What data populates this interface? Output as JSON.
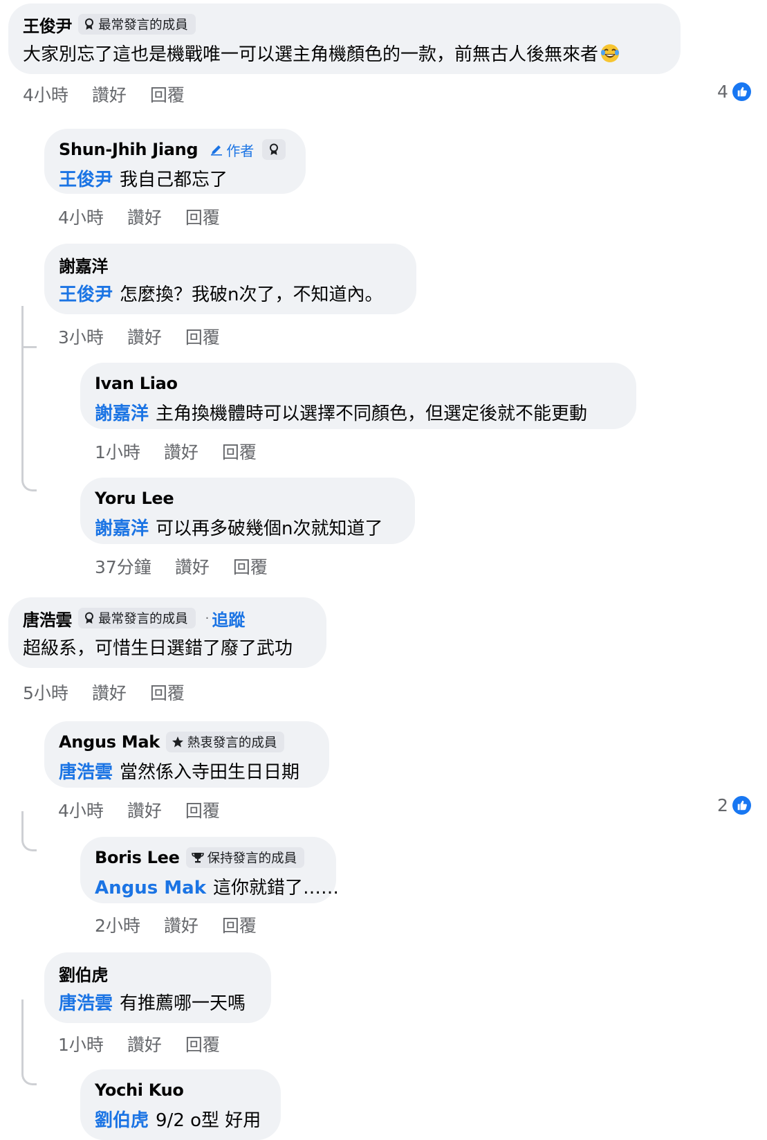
{
  "comments": [
    {
      "name": "王俊尹",
      "badge": "最常發言的成員",
      "text": "大家別忘了這也是機戰唯一可以選主角機顏色的一款，前無古人後無來者",
      "emoji_icon": "laughing-tears-emoji",
      "time": "4小時",
      "like": "讚好",
      "reply": "回覆",
      "reactions": "4"
    },
    {
      "name": "Shun-Jhih Jiang",
      "author_label": "作者",
      "mention": "王俊尹",
      "text": "我自己都忘了",
      "time": "4小時",
      "like": "讚好",
      "reply": "回覆"
    },
    {
      "name": "謝嘉洋",
      "mention": "王俊尹",
      "text": "怎麼換？我破n次了，不知道內。",
      "time": "3小時",
      "like": "讚好",
      "reply": "回覆"
    },
    {
      "name": "Ivan Liao",
      "mention": "謝嘉洋",
      "text": "主角換機體時可以選擇不同顏色，但選定後就不能更動",
      "time": "1小時",
      "like": "讚好",
      "reply": "回覆"
    },
    {
      "name": "Yoru Lee",
      "mention": "謝嘉洋",
      "text": "可以再多破幾個n次就知道了",
      "time": "37分鐘",
      "like": "讚好",
      "reply": "回覆"
    },
    {
      "name": "唐浩雲",
      "badge": "最常發言的成員",
      "follow": "追蹤",
      "text": "超級系，可惜生日選錯了廢了武功",
      "time": "5小時",
      "like": "讚好",
      "reply": "回覆"
    },
    {
      "name": "Angus Mak",
      "badge": "熱衷發言的成員",
      "mention": "唐浩雲",
      "text": "當然係入寺田生日日期",
      "time": "4小時",
      "like": "讚好",
      "reply": "回覆",
      "reactions": "2"
    },
    {
      "name": "Boris Lee",
      "badge": "保持發言的成員",
      "mention": "Angus Mak",
      "text": "這你就錯了……",
      "time": "2小時",
      "like": "讚好",
      "reply": "回覆"
    },
    {
      "name": "劉伯虎",
      "mention": "唐浩雲",
      "text": "有推薦哪一天嗎",
      "time": "1小時",
      "like": "讚好",
      "reply": "回覆"
    },
    {
      "name": "Yochi Kuo",
      "mention": "劉伯虎",
      "text": "9/2 o型 好用"
    }
  ],
  "colors": {
    "bubble": "#f0f2f5",
    "badge_bg": "#e4e6eb",
    "mention": "#1b74e4",
    "meta": "#65676b",
    "thread_line": "#ced0d4",
    "like_icon": "#1877f2"
  }
}
